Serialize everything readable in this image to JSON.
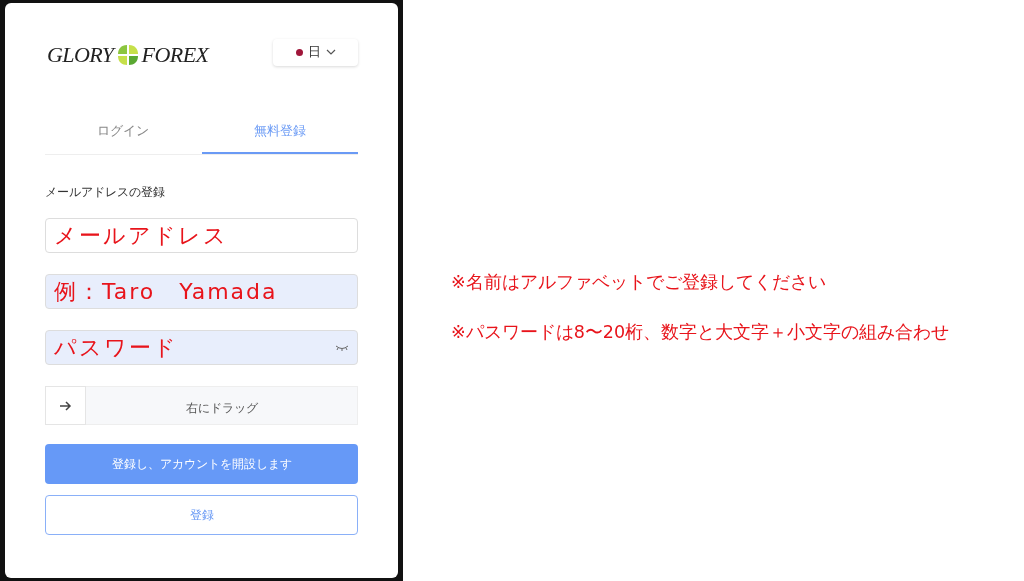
{
  "logo": {
    "left": "GLORY",
    "right": "FOREX"
  },
  "language": {
    "label": "日",
    "color": "#a0163a"
  },
  "tabs": [
    {
      "label": "ログイン",
      "selected": false
    },
    {
      "label": "無料登録",
      "selected": true
    }
  ],
  "section_label": "メールアドレスの登録",
  "fields": [
    {
      "kind": "text",
      "value": "メールアドレス",
      "autofilled": false
    },
    {
      "kind": "text",
      "value": "例：Taro　Yamada",
      "autofilled": true
    },
    {
      "kind": "password",
      "value": "パスワード",
      "autofilled": true
    }
  ],
  "slider": {
    "label": "右にドラッグ"
  },
  "buttons": [
    {
      "kind": "primary",
      "label": "登録し、アカウントを開設します"
    },
    {
      "kind": "outline",
      "label": "登録"
    }
  ],
  "notes": [
    "※名前はアルファベットでご登録してください",
    "※パスワードは8〜20桁、数字と大文字＋小文字の組み合わせ"
  ]
}
